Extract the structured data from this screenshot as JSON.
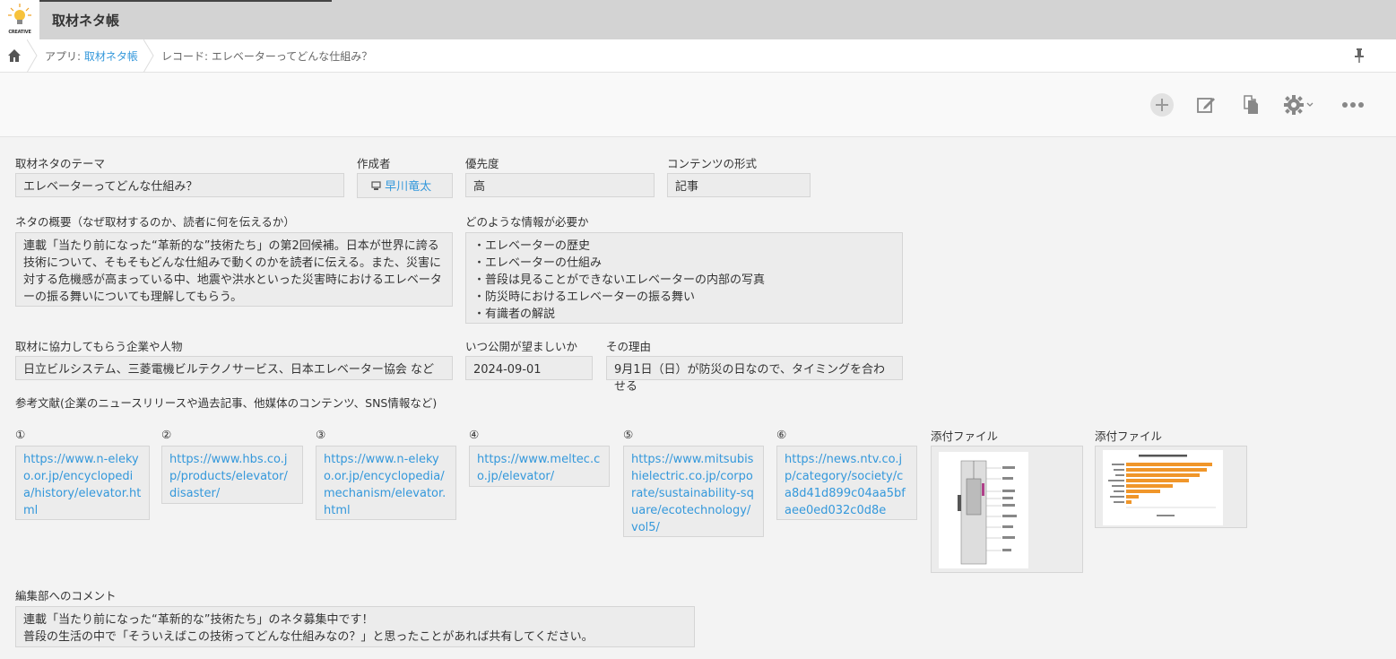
{
  "app": {
    "title": "取材ネタ帳",
    "logo_text": "CREATIVE"
  },
  "breadcrumb": {
    "app_prefix": "アプリ: ",
    "app_link": "取材ネタ帳",
    "record": "レコード: エレベーターってどんな仕組み？"
  },
  "toolbar": {
    "buttons": [
      "plus-icon",
      "edit-icon",
      "copy-icon",
      "gear-icon",
      "more-icon"
    ]
  },
  "fields": {
    "theme": {
      "label": "取材ネタのテーマ",
      "value": "エレベーターってどんな仕組み？"
    },
    "author": {
      "label": "作成者",
      "value": "早川竜太"
    },
    "priority": {
      "label": "優先度",
      "value": "高"
    },
    "format": {
      "label": "コンテンツの形式",
      "value": "記事"
    },
    "summary": {
      "label": "ネタの概要（なぜ取材するのか、読者に何を伝えるか）",
      "value": "連載「当たり前になった“革新的な”技術たち」の第2回候補。日本が世界に誇る技術について、そもそもどんな仕組みで動くのかを読者に伝える。また、災害に対する危機感が高まっている中、地震や洪水といった災害時におけるエレベーターの振る舞いについても理解してもらう。"
    },
    "info_needed": {
      "label": "どのような情報が必要か",
      "value": "・エレベーターの歴史\n・エレベーターの仕組み\n・普段は見ることができないエレベーターの内部の写真\n・防災時におけるエレベーターの振る舞い\n・有識者の解説"
    },
    "partners": {
      "label": "取材に協力してもらう企業や人物",
      "value": "日立ビルシステム、三菱電機ビルテクノサービス、日本エレベーター協会 など"
    },
    "publish_date": {
      "label": "いつ公開が望ましいか",
      "value": "2024-09-01"
    },
    "reason": {
      "label": "その理由",
      "value": "9月1日（日）が防災の日なので、タイミングを合わせる"
    },
    "references_label": "参考文献(企業のニュースリリースや過去記事、他媒体のコンテンツ、SNS情報など)",
    "references": [
      {
        "num": "①",
        "url": "https://www.n-elekyo.or.jp/encyclopedia/history/elevator.html"
      },
      {
        "num": "②",
        "url": "https://www.hbs.co.jp/products/elevator/disaster/"
      },
      {
        "num": "③",
        "url": "https://www.n-elekyo.or.jp/encyclopedia/mechanism/elevator.html"
      },
      {
        "num": "④",
        "url": "https://www.meltec.co.jp/elevator/"
      },
      {
        "num": "⑤",
        "url": "https://www.mitsubishielectric.co.jp/corporate/sustainability-square/ecotechnology/vol5/"
      },
      {
        "num": "⑥",
        "url": "https://news.ntv.co.jp/category/society/ca8d41d899c04aa5bfaee0ed032c0d8e"
      }
    ],
    "attachments": [
      {
        "label": "添付ファイル"
      },
      {
        "label": "添付ファイル"
      }
    ],
    "comment": {
      "label": "編集部へのコメント",
      "value": "連載「当たり前になった“革新的な”技術たち」のネタ募集中です！\n普段の生活の中で「そういえばこの技術ってどんな仕組みなの？」と思ったことがあれば共有してください。"
    }
  }
}
